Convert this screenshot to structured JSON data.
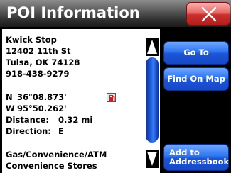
{
  "window": {
    "title": "POI Information",
    "close_icon": "close-x-icon"
  },
  "poi": {
    "name": "Kwick Stop",
    "street": "12402 11th St",
    "city_line": "Tulsa, OK 74128",
    "phone": "918-438-9279",
    "latitude_dir": "N",
    "latitude": "36°08.873'",
    "longitude_dir": "W",
    "longitude": "95°50.262'",
    "distance_label": "Distance:",
    "distance_value": "0.32 mi",
    "direction_label": "Direction:",
    "direction_value": "E",
    "category": "Gas/Convenience/ATM",
    "subcategory": "Convenience Stores"
  },
  "buttons": {
    "go_to": "Go To",
    "find_on_map": "Find On Map",
    "add_to_line1": "Add to",
    "add_to_line2": "Addressbook"
  },
  "icons": {
    "poi_type": "gas-station-icon",
    "scroll_up": "scroll-up-arrow-icon",
    "scroll_down": "scroll-down-arrow-icon"
  },
  "colors": {
    "accent_blue": "#2f73f0",
    "close_red": "#d9403d",
    "background": "#000000",
    "panel": "#ffffff"
  }
}
